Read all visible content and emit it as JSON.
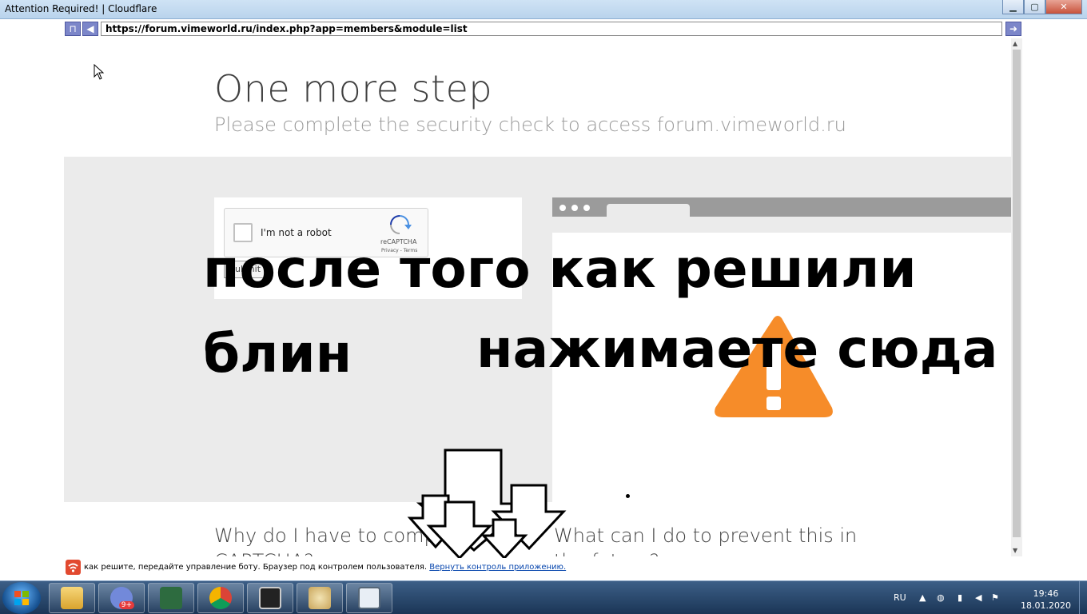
{
  "window": {
    "title": "Attention Required! | Cloudflare",
    "minimize": "▁",
    "maximize": "▢",
    "close": "✕"
  },
  "navbar": {
    "url": "https://forum.vimeworld.ru/index.php?app=members&module=list",
    "back_icon": "◀",
    "history_icon": "⊓",
    "go_icon": "➜"
  },
  "page": {
    "heading": "One more step",
    "subheading": "Please complete the security check to access forum.vimeworld.ru",
    "captcha": {
      "label": "I'm not a robot",
      "brand": "reCAPTCHA",
      "links": "Privacy - Terms",
      "submit": "Submit"
    },
    "faq_left_line1": "Why do I have to complete a",
    "faq_left_line2": "CAPTCHA?",
    "faq_right_line1": "What can I do to prevent this in",
    "faq_right_line2": "the future?"
  },
  "overlay": {
    "line1": "после того как решили",
    "line2": "блин",
    "line3": "нажимаете сюда"
  },
  "status": {
    "text": "как решите, передайте управление боту. Браузер под контролем пользователя.",
    "link": "Вернуть контроль приложению."
  },
  "taskbar": {
    "discord_badge": "9+",
    "lang": "RU",
    "time": "19:46",
    "date": "18.01.2020"
  },
  "colors": {
    "warning": "#f68c29",
    "taskbar": "#1b3556",
    "link": "#0645ad"
  }
}
